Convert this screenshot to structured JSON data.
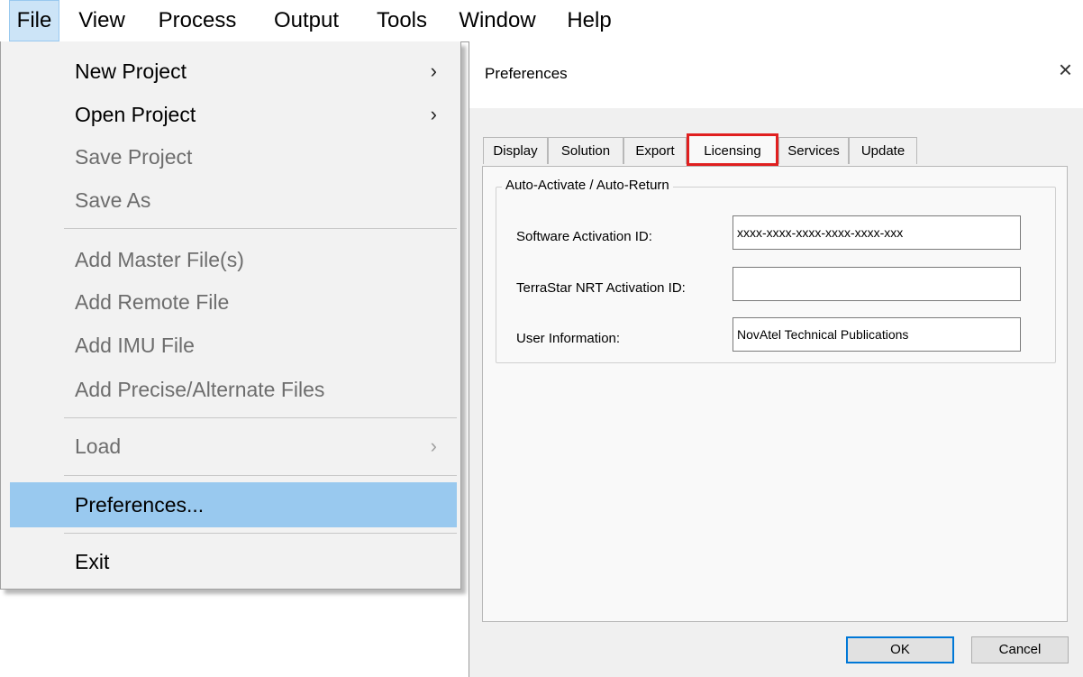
{
  "menubar": {
    "items": [
      "File",
      "View",
      "Process",
      "Output",
      "Tools",
      "Window",
      "Help"
    ]
  },
  "file_menu": {
    "items": [
      {
        "label": "New Project",
        "submenu": true,
        "enabled": true
      },
      {
        "label": "Open Project",
        "submenu": true,
        "enabled": true
      },
      {
        "label": "Save Project",
        "enabled": false
      },
      {
        "label": "Save As",
        "enabled": false
      },
      {
        "label": "Add Master File(s)",
        "enabled": false
      },
      {
        "label": "Add Remote File",
        "enabled": false
      },
      {
        "label": "Add IMU File",
        "enabled": false
      },
      {
        "label": "Add Precise/Alternate Files",
        "enabled": false
      },
      {
        "label": "Load",
        "submenu": true,
        "enabled": false
      },
      {
        "label": "Preferences...",
        "enabled": true,
        "highlighted": true
      },
      {
        "label": "Exit",
        "enabled": true
      }
    ],
    "submenu_arrow": "›"
  },
  "dialog": {
    "title": "Preferences",
    "close_glyph": "×",
    "tabs": [
      "Display",
      "Solution",
      "Export",
      "Licensing",
      "Services",
      "Update"
    ],
    "active_tab": "Licensing",
    "group_title": "Auto-Activate / Auto-Return",
    "fields": [
      {
        "label": "Software Activation ID:",
        "value": "xxxx-xxxx-xxxx-xxxx-xxxx-xxx"
      },
      {
        "label": "TerraStar NRT Activation ID:",
        "value": ""
      },
      {
        "label": "User Information:",
        "value": "NovAtel Technical Publications"
      }
    ],
    "buttons": {
      "ok": "OK",
      "cancel": "Cancel"
    }
  },
  "colors": {
    "menu_highlight": "#99c9ef",
    "active_menubar": "#cce4f7",
    "tab_highlight_border": "#e01f1f",
    "default_button_border": "#0078d7"
  }
}
